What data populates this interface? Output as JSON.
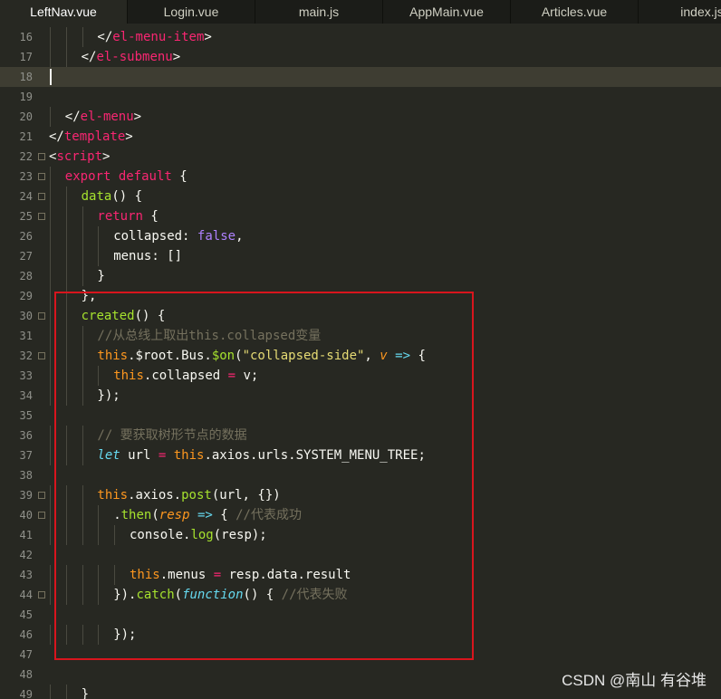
{
  "tabs": [
    {
      "label": "LeftNav.vue",
      "active": true
    },
    {
      "label": "Login.vue",
      "active": false
    },
    {
      "label": "main.js",
      "active": false
    },
    {
      "label": "AppMain.vue",
      "active": false
    },
    {
      "label": "Articles.vue",
      "active": false
    },
    {
      "label": "index.js",
      "active": false
    }
  ],
  "editor": {
    "lines": [
      {
        "n": "16",
        "indent": 3,
        "fold": false,
        "tokens": [
          [
            "t-p",
            "</"
          ],
          [
            "t-tag",
            "el-menu-item"
          ],
          [
            "t-p",
            ">"
          ]
        ]
      },
      {
        "n": "17",
        "indent": 2,
        "fold": false,
        "tokens": [
          [
            "t-p",
            "</"
          ],
          [
            "t-tag",
            "el-submenu"
          ],
          [
            "t-p",
            ">"
          ]
        ]
      },
      {
        "n": "18",
        "indent": 0,
        "fold": false,
        "current": true,
        "tokens": []
      },
      {
        "n": "19",
        "indent": 0,
        "fold": false,
        "tokens": []
      },
      {
        "n": "20",
        "indent": 1,
        "fold": false,
        "tokens": [
          [
            "t-p",
            "</"
          ],
          [
            "t-tag",
            "el-menu"
          ],
          [
            "t-p",
            ">"
          ]
        ]
      },
      {
        "n": "21",
        "indent": 0,
        "fold": false,
        "tokens": [
          [
            "t-p",
            "</"
          ],
          [
            "t-tag",
            "template"
          ],
          [
            "t-p",
            ">"
          ]
        ]
      },
      {
        "n": "22",
        "indent": 0,
        "fold": true,
        "tokens": [
          [
            "t-p",
            "<"
          ],
          [
            "t-tag",
            "script"
          ],
          [
            "t-p",
            ">"
          ]
        ]
      },
      {
        "n": "23",
        "indent": 1,
        "fold": true,
        "tokens": [
          [
            "t-kw",
            "export"
          ],
          [
            "t-p",
            " "
          ],
          [
            "t-kw",
            "default"
          ],
          [
            "t-p",
            " {"
          ]
        ]
      },
      {
        "n": "24",
        "indent": 2,
        "fold": true,
        "tokens": [
          [
            "t-fn",
            "data"
          ],
          [
            "t-p",
            "() {"
          ]
        ]
      },
      {
        "n": "25",
        "indent": 3,
        "fold": true,
        "tokens": [
          [
            "t-kw",
            "return"
          ],
          [
            "t-p",
            " {"
          ]
        ]
      },
      {
        "n": "26",
        "indent": 4,
        "fold": false,
        "tokens": [
          [
            "t-p",
            "collapsed: "
          ],
          [
            "t-const",
            "false"
          ],
          [
            "t-p",
            ","
          ]
        ]
      },
      {
        "n": "27",
        "indent": 4,
        "fold": false,
        "tokens": [
          [
            "t-p",
            "menus: []"
          ]
        ]
      },
      {
        "n": "28",
        "indent": 3,
        "fold": false,
        "tokens": [
          [
            "t-p",
            "}"
          ]
        ]
      },
      {
        "n": "29",
        "indent": 2,
        "fold": false,
        "tokens": [
          [
            "t-p",
            "},"
          ]
        ]
      },
      {
        "n": "30",
        "indent": 2,
        "fold": true,
        "tokens": [
          [
            "t-fn",
            "created"
          ],
          [
            "t-p",
            "() {"
          ]
        ]
      },
      {
        "n": "31",
        "indent": 3,
        "fold": false,
        "tokens": [
          [
            "t-cmt",
            "//从总线上取出this.collapsed变量"
          ]
        ]
      },
      {
        "n": "32",
        "indent": 3,
        "fold": true,
        "tokens": [
          [
            "t-sup",
            "this"
          ],
          [
            "t-p",
            ".$root.Bus."
          ],
          [
            "t-fn",
            "$on"
          ],
          [
            "t-p",
            "("
          ],
          [
            "t-str",
            "\"collapsed-side\""
          ],
          [
            "t-p",
            ", "
          ],
          [
            "t-param",
            "v"
          ],
          [
            "t-p",
            " "
          ],
          [
            "t-arrow",
            "=>"
          ],
          [
            "t-p",
            " {"
          ]
        ]
      },
      {
        "n": "33",
        "indent": 4,
        "fold": false,
        "tokens": [
          [
            "t-sup",
            "this"
          ],
          [
            "t-p",
            ".collapsed "
          ],
          [
            "t-kw",
            "="
          ],
          [
            "t-p",
            " v;"
          ]
        ]
      },
      {
        "n": "34",
        "indent": 3,
        "fold": false,
        "tokens": [
          [
            "t-p",
            "});"
          ]
        ]
      },
      {
        "n": "35",
        "indent": 0,
        "fold": false,
        "tokens": []
      },
      {
        "n": "36",
        "indent": 3,
        "fold": false,
        "tokens": [
          [
            "t-cmt",
            "// 要获取树形节点的数据"
          ]
        ]
      },
      {
        "n": "37",
        "indent": 3,
        "fold": false,
        "tokens": [
          [
            "t-sto",
            "let"
          ],
          [
            "t-p",
            " url "
          ],
          [
            "t-kw",
            "="
          ],
          [
            "t-p",
            " "
          ],
          [
            "t-sup",
            "this"
          ],
          [
            "t-p",
            ".axios.urls.SYSTEM_MENU_TREE;"
          ]
        ]
      },
      {
        "n": "38",
        "indent": 0,
        "fold": false,
        "tokens": []
      },
      {
        "n": "39",
        "indent": 3,
        "fold": true,
        "tokens": [
          [
            "t-sup",
            "this"
          ],
          [
            "t-p",
            ".axios."
          ],
          [
            "t-fn",
            "post"
          ],
          [
            "t-p",
            "(url, {})"
          ]
        ]
      },
      {
        "n": "40",
        "indent": 4,
        "fold": true,
        "tokens": [
          [
            "t-p",
            "."
          ],
          [
            "t-fn",
            "then"
          ],
          [
            "t-p",
            "("
          ],
          [
            "t-param",
            "resp"
          ],
          [
            "t-p",
            " "
          ],
          [
            "t-arrow",
            "=>"
          ],
          [
            "t-p",
            " { "
          ],
          [
            "t-cmt",
            "//代表成功"
          ]
        ]
      },
      {
        "n": "41",
        "indent": 5,
        "fold": false,
        "tokens": [
          [
            "t-p",
            "console."
          ],
          [
            "t-fn",
            "log"
          ],
          [
            "t-p",
            "(resp);"
          ]
        ]
      },
      {
        "n": "42",
        "indent": 0,
        "fold": false,
        "tokens": []
      },
      {
        "n": "43",
        "indent": 5,
        "fold": false,
        "tokens": [
          [
            "t-sup",
            "this"
          ],
          [
            "t-p",
            ".menus "
          ],
          [
            "t-kw",
            "="
          ],
          [
            "t-p",
            " resp.data.result"
          ]
        ]
      },
      {
        "n": "44",
        "indent": 4,
        "fold": true,
        "tokens": [
          [
            "t-p",
            "})."
          ],
          [
            "t-fn",
            "catch"
          ],
          [
            "t-p",
            "("
          ],
          [
            "t-sto",
            "function"
          ],
          [
            "t-p",
            "() { "
          ],
          [
            "t-cmt",
            "//代表失败"
          ]
        ]
      },
      {
        "n": "45",
        "indent": 0,
        "fold": false,
        "tokens": []
      },
      {
        "n": "46",
        "indent": 4,
        "fold": false,
        "tokens": [
          [
            "t-p",
            "});"
          ]
        ]
      },
      {
        "n": "47",
        "indent": 0,
        "fold": false,
        "tokens": []
      },
      {
        "n": "48",
        "indent": 0,
        "fold": false,
        "tokens": []
      },
      {
        "n": "49",
        "indent": 2,
        "fold": false,
        "tokens": [
          [
            "t-p",
            "}"
          ]
        ]
      }
    ]
  },
  "watermark": "CSDN @南山 有谷堆"
}
